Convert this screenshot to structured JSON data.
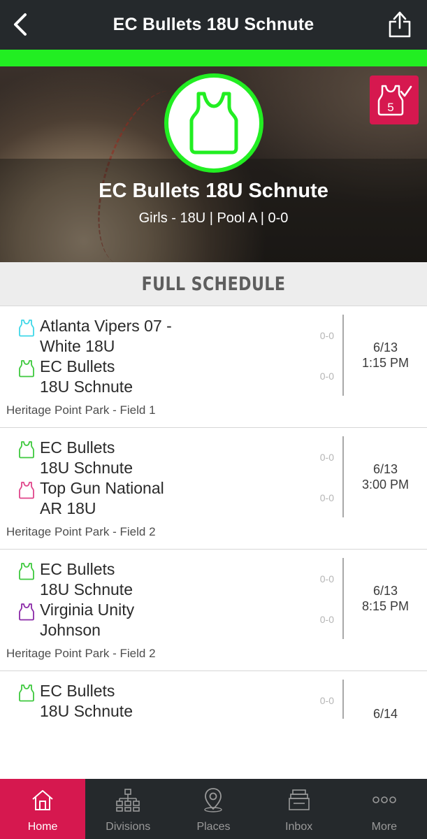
{
  "header": {
    "title": "EC Bullets 18U Schnute",
    "back_icon": "chevron-left-icon",
    "share_icon": "share-icon"
  },
  "colors": {
    "accent_green": "#22ee22",
    "brand_pink": "#d6184f",
    "nav_dark": "#25292c"
  },
  "hero": {
    "team_name": "EC Bullets 18U Schnute",
    "subtitle": "Girls - 18U | Pool A | 0-0",
    "badge_count": "5",
    "badge_icon": "jersey-check-icon"
  },
  "schedule": {
    "title": "FULL SCHEDULE",
    "games": [
      {
        "team1": {
          "line1": "Atlanta Vipers 07 -",
          "line2": "White 18U",
          "color": "#3fd7e8",
          "score": "0-0"
        },
        "team2": {
          "line1": "EC Bullets",
          "line2": "18U Schnute",
          "color": "#3ec93e",
          "score": "0-0"
        },
        "date": "6/13",
        "time": "1:15 PM",
        "venue": "Heritage Point Park - Field 1"
      },
      {
        "team1": {
          "line1": "EC Bullets",
          "line2": "18U Schnute",
          "color": "#3ec93e",
          "score": "0-0"
        },
        "team2": {
          "line1": "Top Gun National",
          "line2": "AR 18U",
          "color": "#e0458a",
          "score": "0-0"
        },
        "date": "6/13",
        "time": "3:00 PM",
        "venue": "Heritage Point Park - Field 2"
      },
      {
        "team1": {
          "line1": "EC Bullets",
          "line2": "18U Schnute",
          "color": "#3ec93e",
          "score": "0-0"
        },
        "team2": {
          "line1": "Virginia Unity",
          "line2": "Johnson",
          "color": "#8b2aa8",
          "score": "0-0"
        },
        "date": "6/13",
        "time": "8:15 PM",
        "venue": "Heritage Point Park - Field 2"
      },
      {
        "team1": {
          "line1": "EC Bullets",
          "line2": "18U Schnute",
          "color": "#3ec93e",
          "score": "0-0"
        },
        "date": "6/14"
      }
    ]
  },
  "tabs": [
    {
      "label": "Home",
      "icon": "home-icon",
      "active": true
    },
    {
      "label": "Divisions",
      "icon": "divisions-icon",
      "active": false
    },
    {
      "label": "Places",
      "icon": "map-pin-icon",
      "active": false
    },
    {
      "label": "Inbox",
      "icon": "inbox-icon",
      "active": false
    },
    {
      "label": "More",
      "icon": "more-icon",
      "active": false
    }
  ]
}
